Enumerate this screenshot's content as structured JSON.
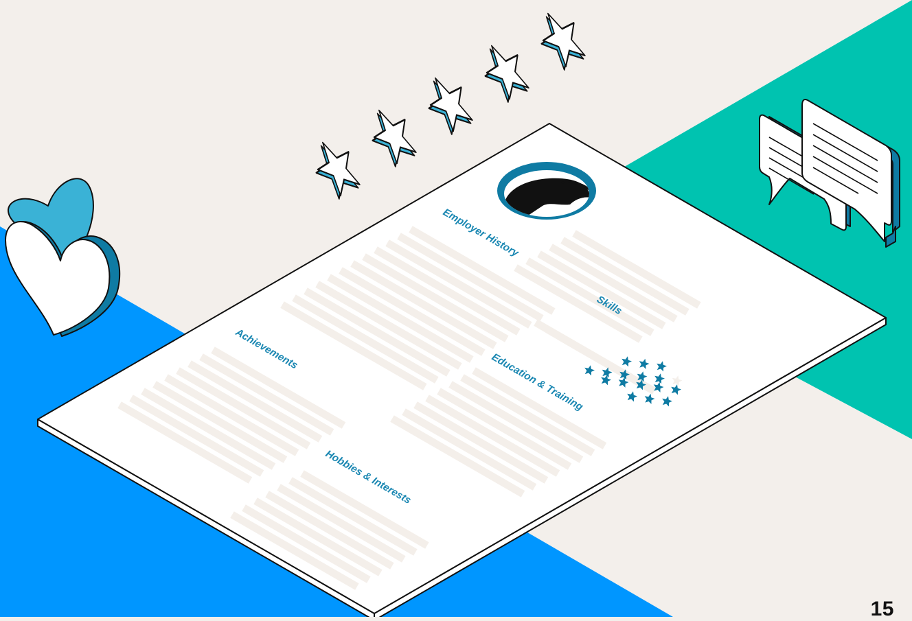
{
  "resume": {
    "sections": {
      "employer_history": "Employer History",
      "skills": "Skills",
      "achievements": "Achievements",
      "education_training": "Education & Training",
      "hobbies_interests": "Hobbies & Interests"
    },
    "skill_ratings": [
      {
        "filled": 3,
        "total": 3
      },
      {
        "filled": 5,
        "total": 6
      },
      {
        "filled": 5,
        "total": 5
      },
      {
        "filled": 3,
        "total": 3
      }
    ]
  },
  "decorations": {
    "rating_stars_count": 5,
    "icons": [
      "heart-icon",
      "chat-bubbles-icon",
      "rating-stars-icon",
      "avatar-icon"
    ]
  },
  "colors": {
    "background": "#f3efeb",
    "blue": "#0096ff",
    "teal": "#00c3b0",
    "accent": "#1a87b2",
    "line": "#f4efea",
    "star_light": "#3ab2d6"
  },
  "page_number": "15"
}
